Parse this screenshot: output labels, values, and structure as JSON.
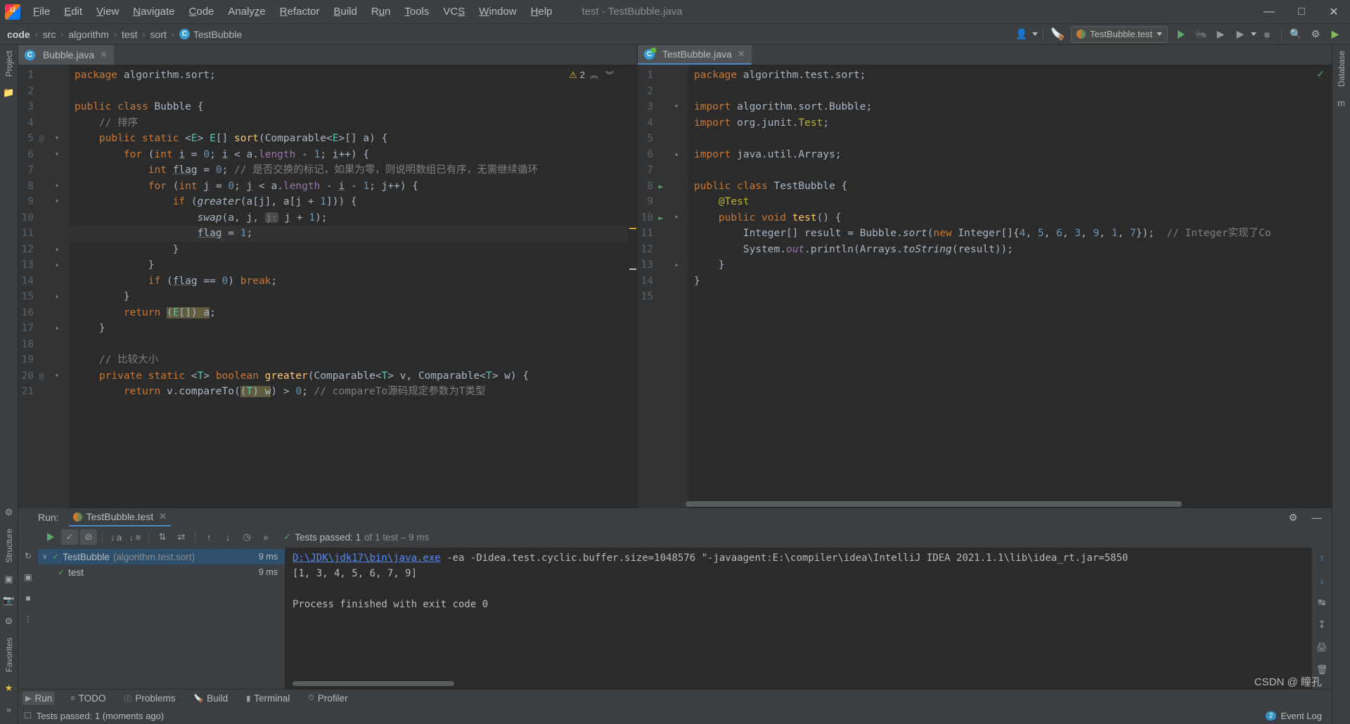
{
  "window": {
    "title": "test - TestBubble.java",
    "logo_icon": "intellij-idea-logo",
    "minimize": "—",
    "maximize": "□",
    "close": "✕"
  },
  "menubar": [
    {
      "label": "File"
    },
    {
      "label": "Edit"
    },
    {
      "label": "View"
    },
    {
      "label": "Navigate"
    },
    {
      "label": "Code"
    },
    {
      "label": "Analyze"
    },
    {
      "label": "Refactor"
    },
    {
      "label": "Build"
    },
    {
      "label": "Run"
    },
    {
      "label": "Tools"
    },
    {
      "label": "VCS"
    },
    {
      "label": "Window"
    },
    {
      "label": "Help"
    }
  ],
  "breadcrumb": {
    "items": [
      "code",
      "src",
      "algorithm",
      "test",
      "sort"
    ],
    "leaf": "TestBubble",
    "leaf_icon": "java-class-icon",
    "separator": "›"
  },
  "toolbar": {
    "avatar_icon": "user-avatar-icon",
    "build_icon": "hammer-build-icon",
    "run_config": "TestBubble.test",
    "run_config_icon": "junit-config-icon",
    "run_icon": "run-play-icon",
    "debug_icon": "debug-bug-icon",
    "run_coverage_icon": "run-with-coverage-icon",
    "more_icon": "more-run-options-icon",
    "stop_icon": "stop-square-icon",
    "search_icon": "search-everywhere-icon",
    "settings_icon": "settings-gear-icon",
    "updates_icon": "idea-updates-icon"
  },
  "left_strip": {
    "project_tab": "Project",
    "bookmarks_icon": "folder-icon",
    "structure_tab": "Structure",
    "favorites_tab": "Favorites",
    "build_icon": "build-icon",
    "commit_icon": "commit-icon",
    "star_icon": "star-icon",
    "more_icon": "»"
  },
  "right_strip": {
    "database_tab": "Database",
    "maven_icon": "maven-icon"
  },
  "editors": [
    {
      "tab_label": "Bubble.java",
      "tab_icon": "java-class-icon",
      "close_icon": "close-icon",
      "active": false,
      "warnings": {
        "count": "2",
        "icon": "warning-triangle-icon",
        "up": "⌃",
        "down": "⌄"
      },
      "lines": [
        {
          "num": "1",
          "marks": "",
          "html": "<span class=\"k\">package</span> algorithm.sort;"
        },
        {
          "num": "2",
          "marks": "",
          "html": ""
        },
        {
          "num": "3",
          "marks": "",
          "html": "<span class=\"k\">public class</span> <span class=\"t\">Bubble</span> {"
        },
        {
          "num": "4",
          "marks": "",
          "html": "    <span class=\"c\">// 排序</span>"
        },
        {
          "num": "5",
          "marks": "@",
          "fold": "open",
          "html": "    <span class=\"k\">public static</span> &lt;<span class=\"g\">E</span>&gt; <span class=\"g\">E</span>[] <span class=\"f\">sort</span>(<span class=\"t\">Comparable</span>&lt;<span class=\"g\">E</span>&gt;[] a) {"
        },
        {
          "num": "6",
          "marks": "",
          "fold": "open",
          "html": "        <span class=\"k\">for</span> (<span class=\"k\">int</span> <span class=\"ul\">i</span> = <span class=\"n\">0</span>; <span class=\"ul\">i</span> &lt; a.<span class=\"fld\">length</span> - <span class=\"n\">1</span>; <span class=\"ul\">i</span>++) {"
        },
        {
          "num": "7",
          "marks": "",
          "html": "            <span class=\"k\">int</span> <span class=\"ul\">flag</span> = <span class=\"n\">0</span>; <span class=\"c\">// 是否交换的标记，如果为零，则说明数组已有序，无需继续循环</span>"
        },
        {
          "num": "8",
          "marks": "",
          "fold": "open",
          "html": "            <span class=\"k\">for</span> (<span class=\"k\">int</span> <span class=\"ul\">j</span> = <span class=\"n\">0</span>; <span class=\"ul\">j</span> &lt; a.<span class=\"fld\">length</span> - <span class=\"ul\">i</span> - <span class=\"n\">1</span>; <span class=\"ul\">j</span>++) {"
        },
        {
          "num": "9",
          "marks": "",
          "fold": "open",
          "html": "                <span class=\"k\">if</span> (<span class=\"it\">greater</span>(a[<span class=\"ul\">j</span>], a[<span class=\"ul\">j</span> + <span class=\"n\">1</span>])) {"
        },
        {
          "num": "10",
          "marks": "",
          "html": "                    <span class=\"it\">swap</span>(a, <span class=\"ul\">j</span>, <span class=\"hint\">j:</span> <span class=\"ul\">j</span> + <span class=\"n\">1</span>);"
        },
        {
          "num": "11",
          "marks": "",
          "highlight": true,
          "html": "                    <span class=\"ul\">flag</span> = <span class=\"n\">1</span>;"
        },
        {
          "num": "12",
          "marks": "",
          "fold": "close",
          "html": "                }"
        },
        {
          "num": "13",
          "marks": "",
          "fold": "close",
          "html": "            }"
        },
        {
          "num": "14",
          "marks": "",
          "html": "            <span class=\"k\">if</span> (<span class=\"ul\">flag</span> == <span class=\"n\">0</span>) <span class=\"k\">break</span>;"
        },
        {
          "num": "15",
          "marks": "",
          "fold": "close",
          "html": "        }"
        },
        {
          "num": "16",
          "marks": "",
          "html": "        <span class=\"k\">return</span> <span class=\"castsel\">(<span class=\"g\">E</span>[]) a</span>;"
        },
        {
          "num": "17",
          "marks": "",
          "fold": "close",
          "html": "    }"
        },
        {
          "num": "18",
          "marks": "",
          "html": ""
        },
        {
          "num": "19",
          "marks": "",
          "html": "    <span class=\"c\">// 比较大小</span>"
        },
        {
          "num": "20",
          "marks": "@",
          "fold": "open",
          "html": "    <span class=\"k\">private static</span> &lt;<span class=\"g\">T</span>&gt; <span class=\"k\">boolean</span> <span class=\"f\">greater</span>(<span class=\"t\">Comparable</span>&lt;<span class=\"g\">T</span>&gt; v, <span class=\"t\">Comparable</span>&lt;<span class=\"g\">T</span>&gt; w) {"
        },
        {
          "num": "21",
          "marks": "",
          "html": "        <span class=\"k\">return</span> v.compareTo(<span class=\"castsel\">(<span class=\"g\">T</span>) w</span>) &gt; <span class=\"n\">0</span>; <span class=\"c\">// compareTo源码规定参数为T类型</span>"
        }
      ]
    },
    {
      "tab_label": "TestBubble.java",
      "tab_icon": "java-test-class-icon",
      "close_icon": "close-icon",
      "active": true,
      "ok_icon": "inspection-ok-check-icon",
      "lines": [
        {
          "num": "1",
          "marks": "",
          "html": "<span class=\"k\">package</span> algorithm.test.sort;"
        },
        {
          "num": "2",
          "marks": "",
          "html": ""
        },
        {
          "num": "3",
          "marks": "",
          "fold": "open",
          "html": "<span class=\"k\">import</span> algorithm.sort.<span class=\"t\">Bubble</span>;"
        },
        {
          "num": "4",
          "marks": "",
          "html": "<span class=\"k\">import</span> org.junit.<span class=\"ann\">Test</span>;"
        },
        {
          "num": "5",
          "marks": "",
          "html": ""
        },
        {
          "num": "6",
          "marks": "",
          "fold": "close",
          "html": "<span class=\"k\">import</span> java.util.<span class=\"t\">Arrays</span>;"
        },
        {
          "num": "7",
          "marks": "",
          "html": ""
        },
        {
          "num": "8",
          "marks": "run",
          "html": "<span class=\"k\">public class</span> <span class=\"t\">TestBubble</span> {"
        },
        {
          "num": "9",
          "marks": "",
          "html": "    <span class=\"ann\">@Test</span>"
        },
        {
          "num": "10",
          "marks": "run",
          "fold": "open",
          "html": "    <span class=\"k\">public void</span> <span class=\"f\">test</span>() {"
        },
        {
          "num": "11",
          "marks": "",
          "html": "        <span class=\"t\">Integer</span>[] result = <span class=\"t\">Bubble</span>.<span class=\"it\">sort</span>(<span class=\"k\">new</span> <span class=\"t\">Integer</span>[]{<span class=\"n\">4</span>, <span class=\"n\">5</span>, <span class=\"n\">6</span>, <span class=\"n\">3</span>, <span class=\"n\">9</span>, <span class=\"n\">1</span>, <span class=\"n\">7</span>});  <span class=\"c\">// Integer实现了Co</span>"
        },
        {
          "num": "12",
          "marks": "",
          "html": "        <span class=\"t\">System</span>.<span class=\"fld it\">out</span>.println(<span class=\"t\">Arrays</span>.<span class=\"it\">toString</span>(result));"
        },
        {
          "num": "13",
          "marks": "",
          "fold": "close",
          "html": "    }"
        },
        {
          "num": "14",
          "marks": "",
          "html": "}"
        },
        {
          "num": "15",
          "marks": "",
          "html": ""
        }
      ]
    }
  ],
  "run_panel": {
    "label": "Run:",
    "tab": "TestBubble.test",
    "tab_icon": "junit-config-icon",
    "close_icon": "close-icon",
    "settings_icon": "settings-gear-icon",
    "minimize_icon": "minimize-icon",
    "left_tools": [
      "rerun-icon",
      "rerun-failed-icon",
      "stop-icon",
      "more-icon"
    ],
    "actions": {
      "run_icon": "rerun-play-icon",
      "show_passed_icon": "show-passed-check-icon",
      "show_ignored_icon": "show-ignored-icon",
      "sort_alpha_icon": "sort-alphabetically-icon",
      "sort_duration_icon": "sort-by-duration-icon",
      "expand_icon": "expand-all-icon",
      "collapse_icon": "collapse-all-icon",
      "prev_icon": "previous-failed-icon",
      "next_icon": "next-failed-icon",
      "history_icon": "test-history-icon",
      "overflow_icon": "»"
    },
    "status": {
      "check_icon": "green-check-icon",
      "main": "Tests passed: 1",
      "dim": " of 1 test – 9 ms"
    },
    "tree": [
      {
        "arrow": "∨",
        "check_icon": "green-check-icon",
        "name": "TestBubble",
        "package": "(algorithm.test.sort)",
        "duration": "9 ms",
        "selected": true
      },
      {
        "arrow": "",
        "check_icon": "green-check-icon",
        "name": "test",
        "package": "",
        "duration": "9 ms",
        "selected": false
      }
    ],
    "console": {
      "command_link": "D:\\JDK\\jdk17\\bin\\java.exe",
      "command_rest": " -ea -Didea.test.cyclic.buffer.size=1048576 \"-javaagent:E:\\compiler\\idea\\IntelliJ IDEA 2021.1.1\\lib\\idea_rt.jar=5850",
      "output": "[1, 3, 4, 5, 6, 7, 9]",
      "blank": "",
      "exit": "Process finished with exit code 0"
    },
    "console_tools": [
      "scroll-up-icon",
      "scroll-down-icon",
      "soft-wrap-icon",
      "scroll-to-end-icon",
      "print-icon",
      "clear-all-icon"
    ]
  },
  "tool_windows": [
    {
      "label": "Run",
      "icon": "run-play-icon",
      "active": true
    },
    {
      "label": "TODO",
      "icon": "todo-list-icon",
      "active": false
    },
    {
      "label": "Problems",
      "icon": "problems-icon",
      "active": false
    },
    {
      "label": "Build",
      "icon": "build-hammer-icon",
      "active": false
    },
    {
      "label": "Terminal",
      "icon": "terminal-icon",
      "active": false
    },
    {
      "label": "Profiler",
      "icon": "profiler-icon",
      "active": false
    }
  ],
  "statusbar": {
    "icon": "status-message-icon",
    "message": "Tests passed: 1 (moments ago)",
    "event_log": "Event Log",
    "event_badge": "2"
  },
  "watermark": "CSDN @ 瞳孔",
  "colors": {
    "accent_blue": "#4a88c7",
    "green": "#59a869",
    "warning": "#e8bf38",
    "editor_bg": "#2b2b2b",
    "chrome_bg": "#3c3f41",
    "selection": "#2d4f6c"
  }
}
